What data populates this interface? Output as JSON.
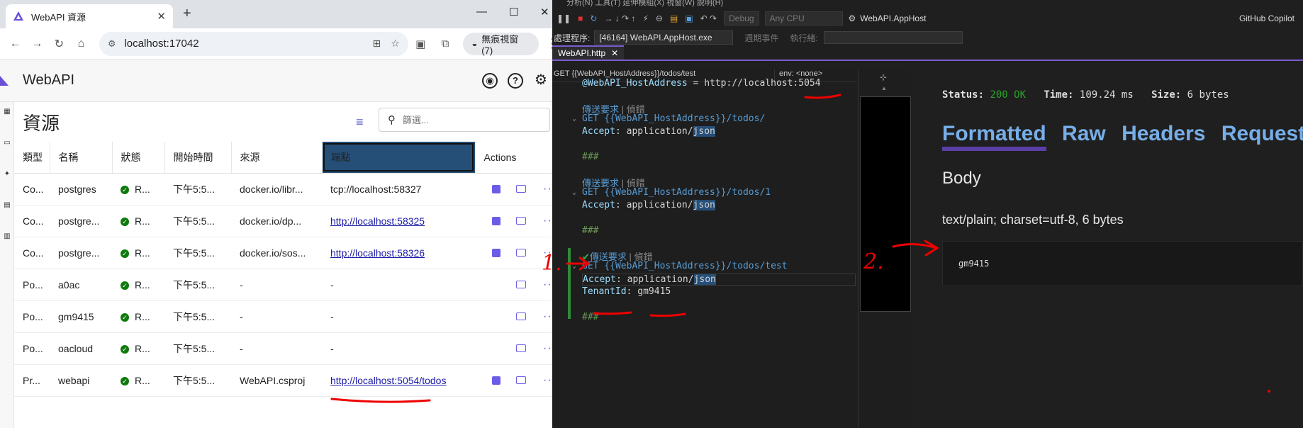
{
  "browser": {
    "tab_title": "WebAPI 資源",
    "url": "localhost:17042",
    "incognito_label": "無痕視窗 (7)",
    "app_name": "WebAPI",
    "page_title": "資源",
    "search_placeholder": "篩選...",
    "columns": [
      "類型",
      "名稱",
      "狀態",
      "開始時間",
      "來源",
      "端點",
      "Actions"
    ],
    "rows": [
      {
        "type": "Co...",
        "name": "postgres",
        "state": "R...",
        "start": "下午5:5...",
        "source": "docker.io/libr...",
        "endpoint": "tcp://localhost:58327",
        "link": false,
        "stop": true
      },
      {
        "type": "Co...",
        "name": "postgre...",
        "state": "R...",
        "start": "下午5:5...",
        "source": "docker.io/dp...",
        "endpoint": "http://localhost:58325",
        "link": true,
        "stop": true
      },
      {
        "type": "Co...",
        "name": "postgre...",
        "state": "R...",
        "start": "下午5:5...",
        "source": "docker.io/sos...",
        "endpoint": "http://localhost:58326",
        "link": true,
        "stop": true
      },
      {
        "type": "Po...",
        "name": "a0ac",
        "state": "R...",
        "start": "下午5:5...",
        "source": "-",
        "endpoint": "-",
        "link": false,
        "stop": false
      },
      {
        "type": "Po...",
        "name": "gm9415",
        "state": "R...",
        "start": "下午5:5...",
        "source": "-",
        "endpoint": "-",
        "link": false,
        "stop": false
      },
      {
        "type": "Po...",
        "name": "oacloud",
        "state": "R...",
        "start": "下午5:5...",
        "source": "-",
        "endpoint": "-",
        "link": false,
        "stop": false
      },
      {
        "type": "Pr...",
        "name": "webapi",
        "state": "R...",
        "start": "下午5:5...",
        "source": "WebAPI.csproj",
        "endpoint": "http://localhost:5054/todos",
        "link": true,
        "stop": true
      }
    ]
  },
  "vs": {
    "menu": "分析(N)      工具(T)      延伸模組(X)      視窗(W)      說明(H)",
    "config": "Debug",
    "platform": "Any CPU",
    "startup": "WebAPI.AppHost",
    "copilot": "GitHub Copilot",
    "process_label": "處理程序:",
    "process": "[46164] WebAPI.AppHost.exe",
    "lifecycle": "週期事件",
    "thread": "執行緒:",
    "doc_tab": "WebAPI.http",
    "nav_request": "GET {{WebAPI_HostAddress}}/todos/test",
    "nav_env": "env: <none>",
    "code": {
      "var_name": "@WebAPI_HostAddress",
      "var_eq": " = http://localhost:",
      "var_port": "5054",
      "send": "傳送要求",
      "sep": " | ",
      "debug": "偵錯",
      "get1": "GET {{WebAPI_HostAddress}}/todos/",
      "get2": "GET {{WebAPI_HostAddress}}/todos/1",
      "get3": "GET {{WebAPI_HostAddress}}/todos/test",
      "accept_key": "Accept",
      "accept_val": ": application/",
      "accept_json": "json",
      "tenant_key": "TenantId",
      "tenant_val": "gm9415",
      "colon": ": ",
      "sepline": "###"
    },
    "response": {
      "status_label": "Status:",
      "status": "200 OK",
      "time_label": "Time:",
      "time": "109.24 ms",
      "size_label": "Size:",
      "size": "6 bytes",
      "tabs": [
        "Formatted",
        "Raw",
        "Headers",
        "Request"
      ],
      "body_title": "Body",
      "content_type": "text/plain; charset=utf-8, 6 bytes",
      "body": "gm9415"
    }
  },
  "annotations": {
    "label1": "1.",
    "label2": "2."
  }
}
